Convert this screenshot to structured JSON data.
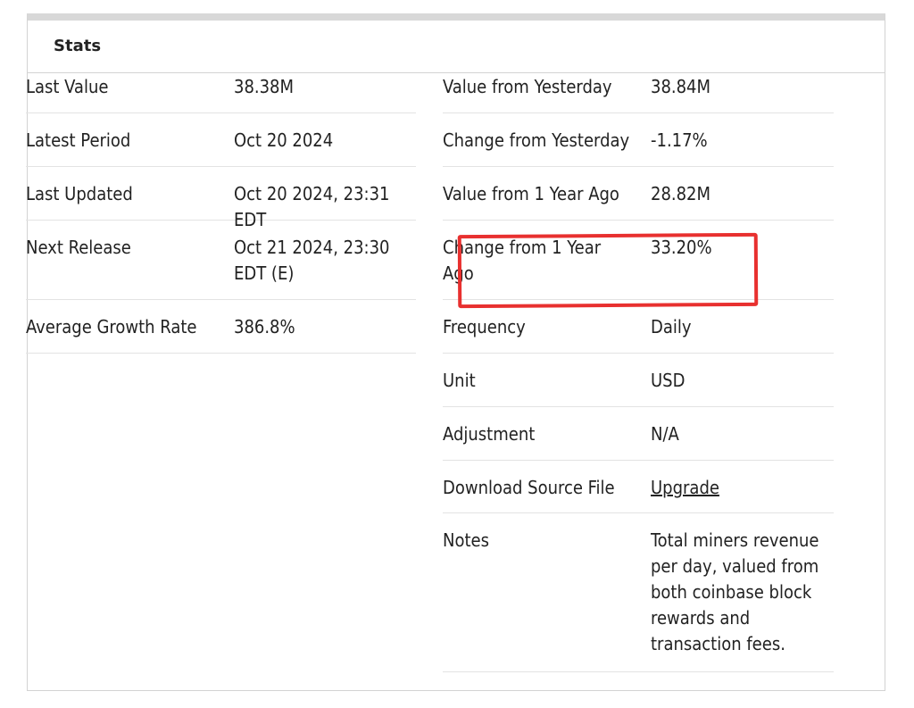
{
  "panel": {
    "title": "Stats"
  },
  "left_rows": [
    {
      "label": "Last Value",
      "value": "38.38M"
    },
    {
      "label": "Latest Period",
      "value": "Oct 20 2024"
    },
    {
      "label": "Last Updated",
      "value": "Oct 20 2024, 23:31 EDT"
    },
    {
      "label": "Next Release",
      "value": "Oct 21 2024, 23:30 EDT (E)"
    },
    {
      "label": "Average Growth Rate",
      "value": "386.8%"
    }
  ],
  "right_rows": [
    {
      "label": "Value from Yesterday",
      "value": "38.84M"
    },
    {
      "label": "Change from Yesterday",
      "value": "-1.17%"
    },
    {
      "label": "Value from 1 Year Ago",
      "value": "28.82M"
    },
    {
      "label": "Change from 1 Year Ago",
      "value": "33.20%"
    },
    {
      "label": "Frequency",
      "value": "Daily"
    },
    {
      "label": "Unit",
      "value": "USD"
    },
    {
      "label": "Adjustment",
      "value": "N/A"
    },
    {
      "label": "Download Source File",
      "value": "Upgrade"
    },
    {
      "label": "Notes",
      "value": "Total miners revenue per day, valued from both coinbase block rewards and transaction fees."
    }
  ],
  "annotation": {
    "highlight_color": "#e8302f"
  }
}
